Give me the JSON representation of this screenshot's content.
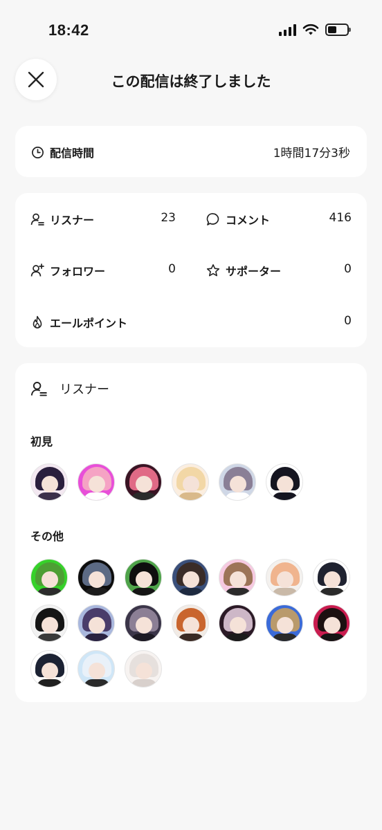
{
  "status_bar": {
    "time": "18:42"
  },
  "header": {
    "title": "この配信は終了しました"
  },
  "duration": {
    "label": "配信時間",
    "value": "1時間17分3秒"
  },
  "stats": {
    "listeners": {
      "label": "リスナー",
      "value": "23"
    },
    "comments": {
      "label": "コメント",
      "value": "416"
    },
    "followers": {
      "label": "フォロワー",
      "value": "0"
    },
    "supporters": {
      "label": "サポーター",
      "value": "0"
    },
    "cheer_points": {
      "label": "エールポイント",
      "value": "0"
    }
  },
  "listeners_section": {
    "title": "リスナー",
    "first_time_label": "初見",
    "others_label": "その他"
  },
  "colors": {
    "accent_text": "#1a1a1a",
    "card_bg": "#ffffff",
    "page_bg": "#f7f7f7"
  },
  "avatars": {
    "first_time": [
      {
        "hair": "#2a1f3d",
        "bg": "#f3e8f1",
        "body": "#3b2f4a"
      },
      {
        "hair": "#f5a3c4",
        "bg": "#e84fd8",
        "body": "#ffffff"
      },
      {
        "hair": "#e06a86",
        "bg": "#3a1424",
        "body": "#2b2b2b"
      },
      {
        "hair": "#f2d7a6",
        "bg": "#fbeee0",
        "body": "#d9b98a"
      },
      {
        "hair": "#8a7f96",
        "bg": "#cfd7e6",
        "body": "#ffffff"
      },
      {
        "hair": "#151520",
        "bg": "#ffffff",
        "body": "#151520"
      }
    ],
    "others": [
      {
        "hair": "#4d9e34",
        "bg": "#36d12a",
        "body": "#2c2c2c"
      },
      {
        "hair": "#5c6a84",
        "bg": "#0d0d0d",
        "body": "#1c1c1c"
      },
      {
        "hair": "#0e0e0e",
        "bg": "#4fa34a",
        "body": "#151515"
      },
      {
        "hair": "#3a2c28",
        "bg": "#3a4f7a",
        "body": "#1e2a40"
      },
      {
        "hair": "#9c7458",
        "bg": "#f6c9e0",
        "body": "#2b2b2b"
      },
      {
        "hair": "#f0b48e",
        "bg": "#f4f1ee",
        "body": "#c9b9a8"
      },
      {
        "hair": "#1f2230",
        "bg": "#ffffff",
        "body": "#2a2a2a"
      },
      {
        "hair": "#151515",
        "bg": "#f2f2f2",
        "body": "#3a3a3a"
      },
      {
        "hair": "#4a3c6a",
        "bg": "#a9b7dd",
        "body": "#2a2240"
      },
      {
        "hair": "#8c7f95",
        "bg": "#3b3549",
        "body": "#1d1a24"
      },
      {
        "hair": "#c9652e",
        "bg": "#f2ebe5",
        "body": "#3a2a24"
      },
      {
        "hair": "#cdb7c7",
        "bg": "#2b1a26",
        "body": "#1b1b1b"
      },
      {
        "hair": "#b99a6c",
        "bg": "#3b6bd8",
        "body": "#2a2a2a"
      },
      {
        "hair": "#1c1010",
        "bg": "#c91c4f",
        "body": "#151515"
      },
      {
        "hair": "#1c2233",
        "bg": "#ffffff",
        "body": "#202020"
      },
      {
        "hair": "#e9f1f9",
        "bg": "#cfe6f7",
        "body": "#2a2a2a"
      },
      {
        "hair": "#e6e0dd",
        "bg": "#f7f3f1",
        "body": "#d8d0cc"
      }
    ]
  }
}
